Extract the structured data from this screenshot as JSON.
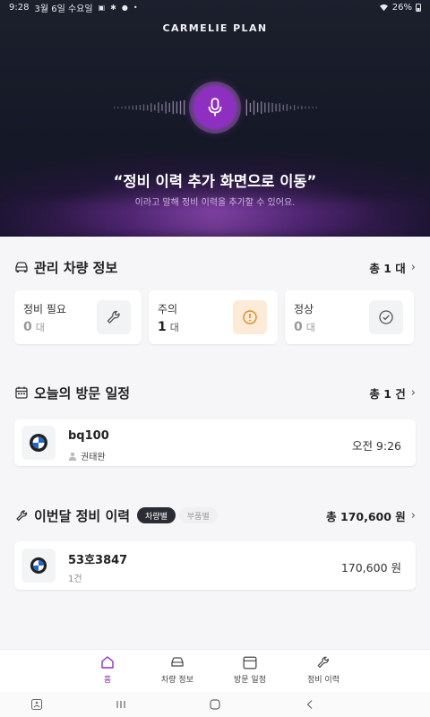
{
  "status_bar": {
    "time": "9:28",
    "date": "3월 6일 수요일",
    "battery": "26%"
  },
  "hero": {
    "brand": "CARMELIE PLAN",
    "quote": "“정비 이력 추가 화면으로 이동”",
    "subtitle": "이라고 말해 정비 이력을 추가할 수 있어요.",
    "accent": "#8d2fbf"
  },
  "vehicles": {
    "title": "관리 차량 정보",
    "total": "총 1 대",
    "stats": [
      {
        "label": "정비 필요",
        "value": "0",
        "unit": "대",
        "icon": "wrench-icon"
      },
      {
        "label": "주의",
        "value": "1",
        "unit": "대",
        "icon": "alert-icon"
      },
      {
        "label": "정상",
        "value": "0",
        "unit": "대",
        "icon": "check-circle-icon"
      }
    ]
  },
  "visits": {
    "title": "오늘의 방문 일정",
    "total": "총 1 건",
    "items": [
      {
        "plate": "bq100",
        "person": "권태완",
        "time": "오전 9:26",
        "logo": "bmw-logo"
      }
    ]
  },
  "history": {
    "title": "이번달 정비 이력",
    "chips": [
      "차량별",
      "부품별"
    ],
    "total": "총 170,600 원",
    "items": [
      {
        "plate": "53호3847",
        "count": "1건",
        "amount": "170,600 원",
        "logo": "bmw-logo"
      }
    ]
  },
  "bottom_nav": [
    {
      "label": "홈",
      "icon": "home-icon",
      "active": true
    },
    {
      "label": "차량 정보",
      "icon": "car-icon",
      "active": false
    },
    {
      "label": "방문 일정",
      "icon": "calendar-icon",
      "active": false
    },
    {
      "label": "정비 이력",
      "icon": "wrench-icon",
      "active": false
    }
  ]
}
